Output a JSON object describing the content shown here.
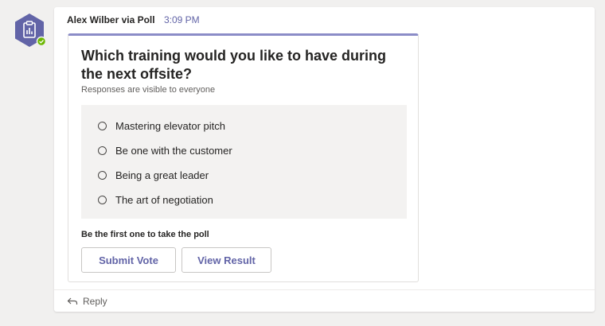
{
  "app": {
    "icon": "poll-clipboard-icon",
    "status_badge_color": "#6bb700",
    "avatar_color": "#6264a7"
  },
  "message": {
    "sender": "Alex Wilber via Poll",
    "time": "3:09 PM"
  },
  "poll": {
    "question": "Which training would you like to have during the next offsite?",
    "subtitle": "Responses are visible to everyone",
    "options": [
      {
        "label": "Mastering elevator pitch"
      },
      {
        "label": "Be one with the customer"
      },
      {
        "label": "Being a great leader"
      },
      {
        "label": "The art of negotiation"
      }
    ],
    "prompt": "Be the first one to take the poll",
    "submit_label": "Submit Vote",
    "view_label": "View Result",
    "accent": "#6264a7"
  },
  "reply": {
    "label": "Reply",
    "icon": "reply-arrow-icon"
  }
}
